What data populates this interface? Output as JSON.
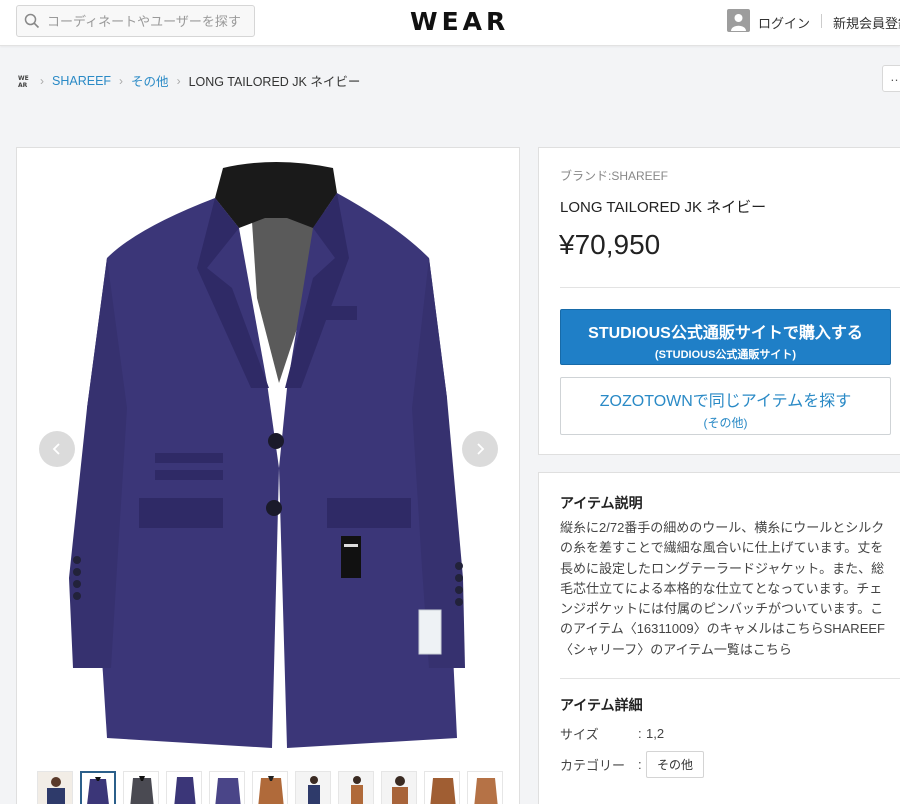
{
  "header": {
    "search_placeholder": "コーディネートやユーザーを探す",
    "logo": "WEAR",
    "login": "ログイン",
    "register": "新規会員登録"
  },
  "breadcrumb": {
    "home_text": "WEAR",
    "items": [
      "SHAREEF",
      "その他",
      "LONG TAILORED JK ネイビー"
    ]
  },
  "more_button": "…",
  "product": {
    "brand_label": "ブランド:SHAREEF",
    "name": "LONG TAILORED JK ネイビー",
    "price": "¥70,950",
    "buy_button": {
      "main": "STUDIOUS公式通販サイトで購入する",
      "sub": "(STUDIOUS公式通販サイト)"
    },
    "zozo_button": {
      "main": "ZOZOTOWNで同じアイテムを探す",
      "sub": "(その他)"
    }
  },
  "description": {
    "title": "アイテム説明",
    "text": "縦糸に2/72番手の細めのウール、横糸にウールとシルクの糸を差すことで繊細な風合いに仕上げています。丈を長めに設定したロングテーラードジャケット。また、総毛芯仕立てによる本格的な仕立てとなっています。チェンジポケットには付属のピンバッチがついています。このアイテム〈16311009〉のキャメルはこちらSHAREEF〈シャリーフ〉のアイテム一覧はこちら"
  },
  "details": {
    "title": "アイテム詳細",
    "size_label": "サイズ",
    "size_value": "1,2",
    "category_label": "カテゴリー",
    "category_value": "その他",
    "colon": ":"
  },
  "thumbnails": [
    "navy-coordinate",
    "navy-jacket",
    "gray-jacket",
    "navy-jacket-side",
    "navy-jacket-back",
    "camel-jacket",
    "navy-coordinate-2",
    "camel-coordinate",
    "camel-coordinate-2",
    "camel-jacket-2",
    "camel-jacket-3"
  ],
  "colors": {
    "accent_blue": "#1f7fc7",
    "link_blue": "#2a8ac6",
    "jacket_navy": "#3b3678",
    "camel": "#b06a3a"
  }
}
